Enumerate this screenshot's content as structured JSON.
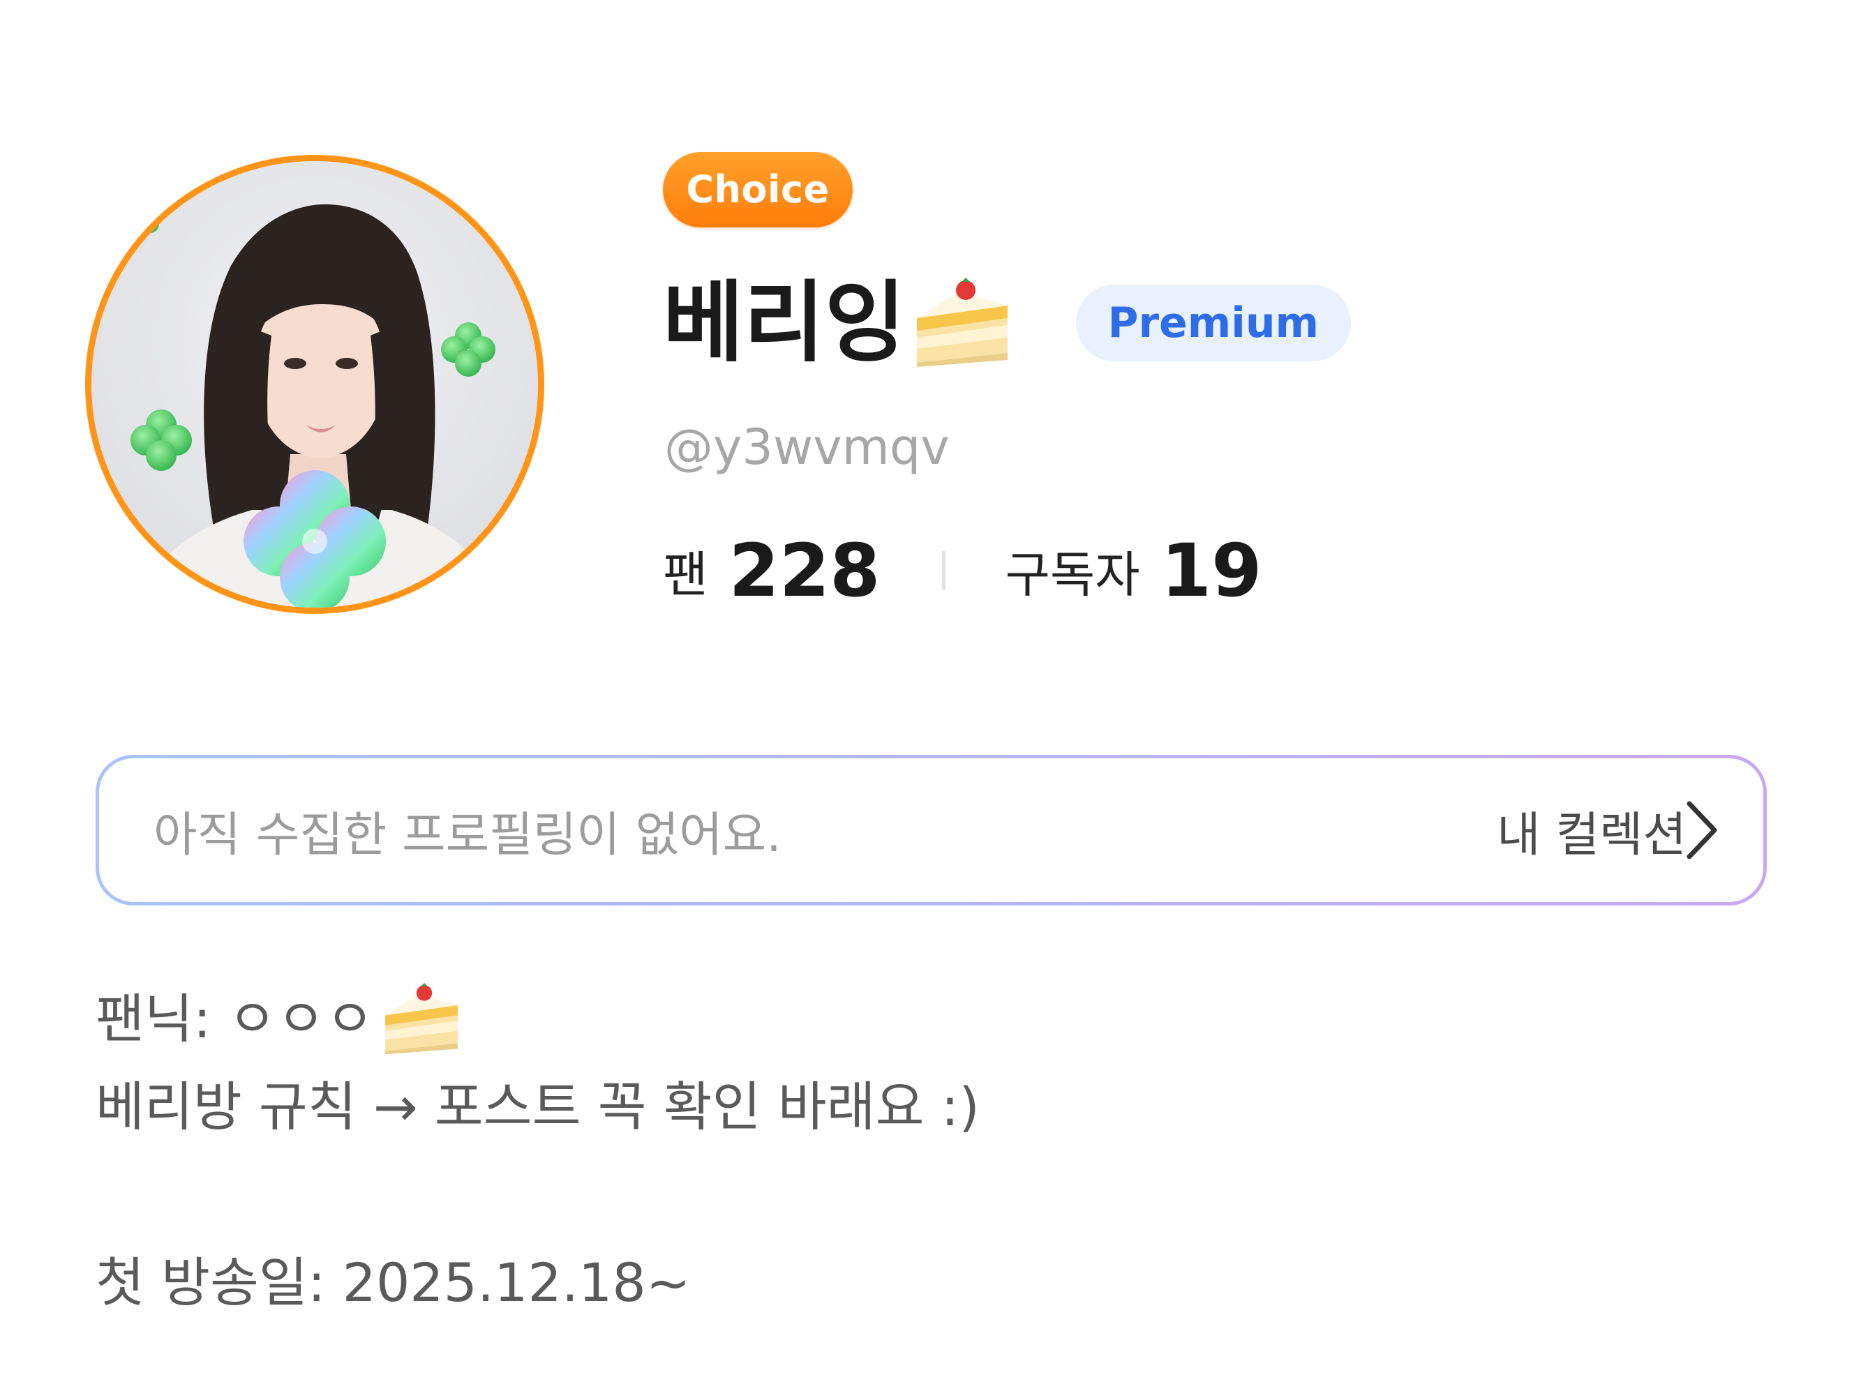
{
  "profile": {
    "choice_badge": "Choice",
    "display_name": "베리잉",
    "name_emoji": "cake-icon",
    "premium_badge": "Premium",
    "handle": "@y3wvmqv",
    "stats": {
      "fans_label": "팬",
      "fans_value": "228",
      "subscribers_label": "구독자",
      "subscribers_value": "19"
    }
  },
  "collection": {
    "empty_text": "아직 수집한 프로필링이 없어요.",
    "link_label": "내 컬렉션"
  },
  "bio": {
    "line1": "팬닉: ㅇㅇㅇ",
    "line2": "베리방 규칙 → 포스트 꼭 확인 바래요 :)",
    "line3": "첫 방송일: 2025.12.18~"
  },
  "colors": {
    "avatar_ring": "#ff9416",
    "choice_badge": "#ff8a12",
    "premium_bg": "#e9f1fd",
    "premium_text": "#2f6de8",
    "collection_border_start": "#a8c4fb",
    "collection_border_end": "#c8a8f2"
  }
}
